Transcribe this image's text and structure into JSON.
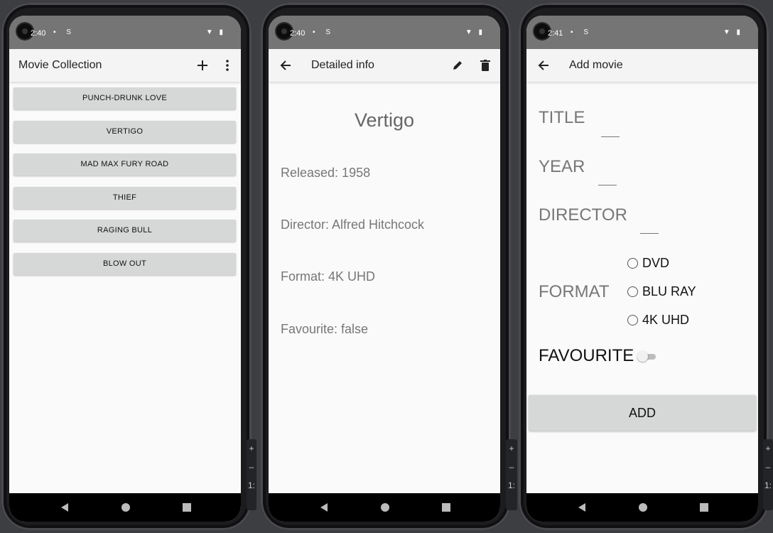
{
  "colors": {
    "status_bar": "#757575",
    "app_bar": "#f4f4f4",
    "button": "#d6d7d7",
    "background": "#fafafa"
  },
  "screen1": {
    "status": {
      "time": "2:40"
    },
    "appbar": {
      "title": "Movie Collection",
      "add_icon": "plus-icon",
      "menu_icon": "more-vert-icon"
    },
    "movies": [
      "PUNCH-DRUNK LOVE",
      "VERTIGO",
      "MAD MAX FURY ROAD",
      "THIEF",
      "RAGING BULL",
      "BLOW OUT"
    ]
  },
  "screen2": {
    "status": {
      "time": "2:40"
    },
    "appbar": {
      "title": "Detailed info",
      "back_icon": "arrow-back-icon",
      "edit_icon": "pencil-icon",
      "delete_icon": "trash-icon"
    },
    "movie_title": "Vertigo",
    "released": "Released: 1958",
    "director": "Director: Alfred Hitchcock",
    "format": "Format: 4K UHD",
    "favourite": "Favourite: false"
  },
  "screen3": {
    "status": {
      "time": "2:41"
    },
    "appbar": {
      "title": "Add movie",
      "back_icon": "arrow-back-icon"
    },
    "labels": {
      "title": "TITLE",
      "year": "YEAR",
      "director": "DIRECTOR",
      "format": "FORMAT",
      "favourite": "FAVOURITE"
    },
    "inputs": {
      "title": "",
      "year": "",
      "director": ""
    },
    "format_options": [
      "DVD",
      "BLU RAY",
      "4K UHD"
    ],
    "favourite_on": false,
    "add_label": "ADD"
  },
  "side_controls": {
    "plus": "+",
    "minus": "–",
    "ratio": "1:"
  }
}
